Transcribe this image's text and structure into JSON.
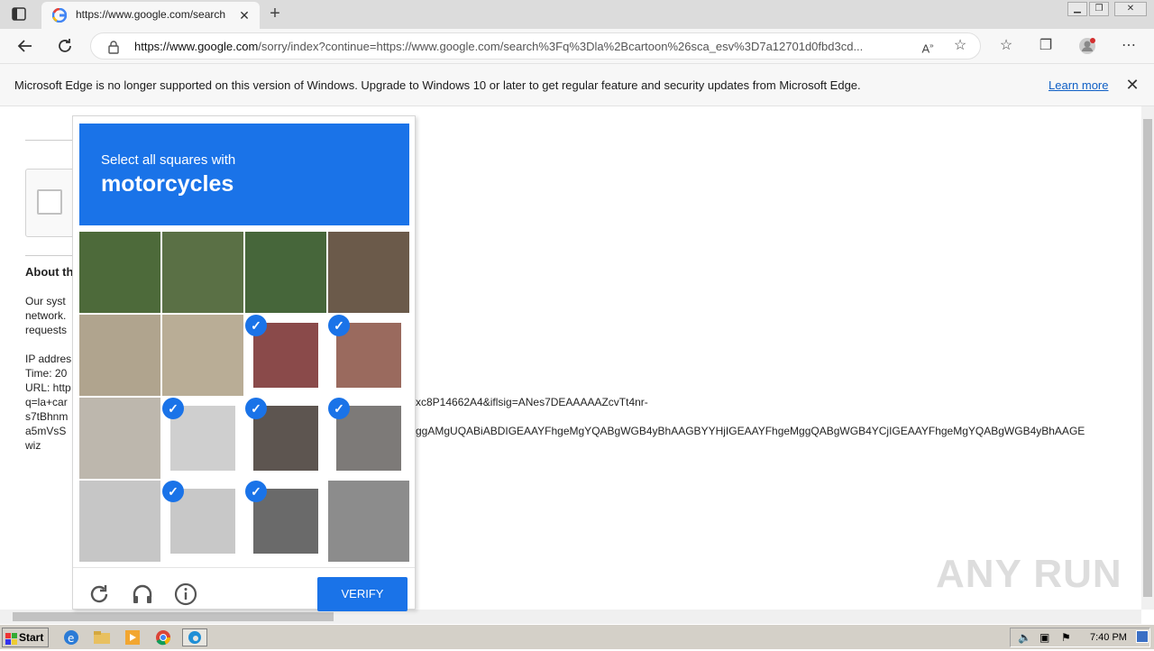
{
  "browser": {
    "tab_title": "https://www.google.com/search",
    "tab_close": "✕",
    "new_tab": "+",
    "url_host": "https://www.google.com",
    "url_rest": "/sorry/index?continue=https://www.google.com/search%3Fq%3Dla%2Bcartoon%26sca_esv%3D7a12701d0fbd3cd...",
    "window_controls": [
      "▁",
      "❐",
      "✕"
    ]
  },
  "banner": {
    "message": "Microsoft Edge is no longer supported on this version of Windows. Upgrade to Windows 10 or later to get regular feature and security updates from Microsoft Edge.",
    "learn_more": "Learn more",
    "close": "✕"
  },
  "page": {
    "about_heading": "About th",
    "lines": [
      "Our syst",
      "network.",
      "requests",
      "IP addres",
      "Time: 20",
      "URL: http",
      "q=la+car",
      "s7tBhnm",
      "a5mVsS",
      "wiz"
    ],
    "overflow_1": "xc8P14662A4&iflsig=ANes7DEAAAAAZcvTt4nr-",
    "overflow_2": "ggAMgUQABiABDIGEAAYFhgeMgYQABgWGB4yBhAAGBYYHjIGEAAYFhgeMggQABgWGB4YCjIGEAAYFhgeMgYQABgWGB4yBhAAGE"
  },
  "captcha": {
    "instruction": "Select all squares with",
    "target": "motorcycles",
    "verify_label": "VERIFY",
    "checkmark": "✓",
    "tiles": [
      {
        "selected": false,
        "color": "#4d6a3a"
      },
      {
        "selected": false,
        "color": "#5a7045"
      },
      {
        "selected": false,
        "color": "#46663a"
      },
      {
        "selected": false,
        "color": "#6b5a4a"
      },
      {
        "selected": false,
        "color": "#b0a48e"
      },
      {
        "selected": false,
        "color": "#b9ad96"
      },
      {
        "selected": true,
        "color": "#8a4a4a"
      },
      {
        "selected": true,
        "color": "#9a6a5e"
      },
      {
        "selected": false,
        "color": "#bdb7ad"
      },
      {
        "selected": true,
        "color": "#cfcfcf"
      },
      {
        "selected": true,
        "color": "#5d5550"
      },
      {
        "selected": true,
        "color": "#7d7a78"
      },
      {
        "selected": false,
        "color": "#c6c6c6"
      },
      {
        "selected": true,
        "color": "#c8c8c8"
      },
      {
        "selected": true,
        "color": "#6a6a6a"
      },
      {
        "selected": false,
        "color": "#8c8c8c"
      }
    ]
  },
  "watermark": "ANY RUN",
  "taskbar": {
    "start_label": "Start",
    "clock": "7:40 PM"
  },
  "colors": {
    "accent": "#1a73e8",
    "link": "#0f5fc5"
  }
}
